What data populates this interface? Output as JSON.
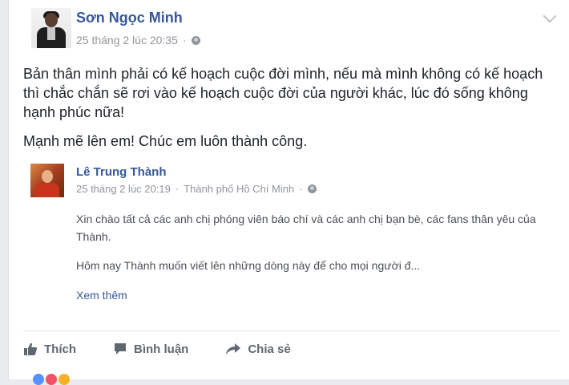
{
  "post": {
    "author": "Sơn Ngọc Minh",
    "timestamp": "25 tháng 2 lúc 20:35",
    "separator": "·",
    "paragraphs": [
      "Bản thân mình phải có kế hoạch cuộc đời mình, nếu mà mình không có kế hoạch thì chắc chắn sẽ rơi vào kế hoạch cuộc đời của người khác, lúc đó sống không hạnh phúc nữa!",
      "Mạnh mẽ lên em! Chúc em luôn thành công."
    ]
  },
  "shared": {
    "author": "Lê Trung Thành",
    "timestamp": "25 tháng 2 lúc 20:19",
    "location": "Thành phố Hồ Chí Minh",
    "separator": "·",
    "paragraphs": [
      "Xin chào tất cả các anh chị phóng viên báo chí và các anh chị bạn bè, các fans thân yêu của Thành.",
      "Hôm nay Thành muốn viết lên những dòng này để cho mọi người đ..."
    ],
    "see_more": "Xem thêm"
  },
  "actions": {
    "like": "Thích",
    "comment": "Bình luận",
    "share": "Chia sẻ"
  },
  "colors": {
    "link": "#365899",
    "meta": "#90949c",
    "text": "#1d2129",
    "action": "#606770",
    "reaction_like": "#5890ff",
    "reaction_love": "#f25268",
    "reaction_haha": "#f7b125"
  },
  "icons": {
    "audience": "globe-icon",
    "menu": "chevron-down-icon",
    "like": "thumbs-up-icon",
    "comment": "comment-icon",
    "share": "share-arrow-icon"
  }
}
